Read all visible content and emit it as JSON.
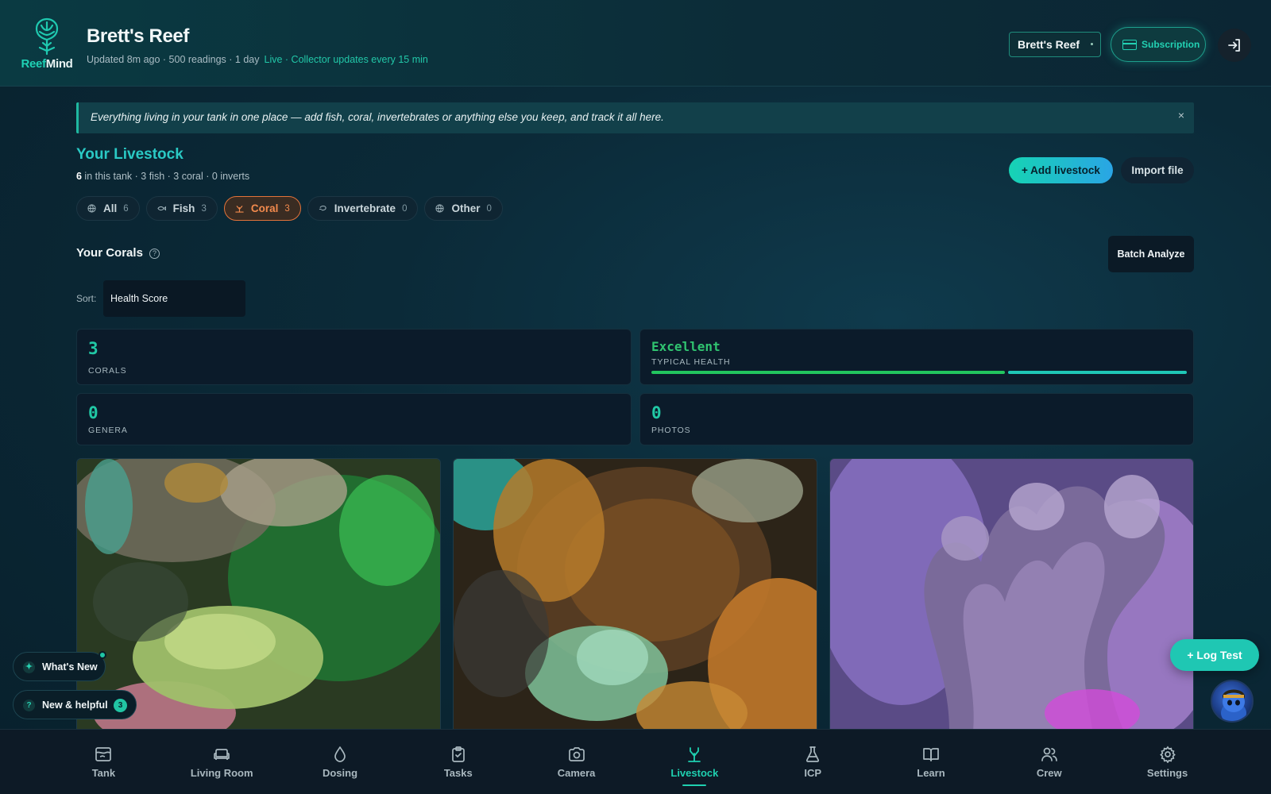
{
  "header": {
    "logo_part1": "Reef",
    "logo_part2": "Mind",
    "title": "Brett's Reef",
    "subline": "Updated 8m ago · 500 readings · 1 day",
    "live": "Live · Collector updates every 15 min",
    "tank_select": "Brett's Reef",
    "subscription_label": "Subscription"
  },
  "banner": {
    "text": "Everything living in your tank in one place — add fish, coral, invertebrates or anything else you keep, and track it all here.",
    "close": "×"
  },
  "livestock": {
    "title": "Your Livestock",
    "count_bold": "6",
    "count_rest": " in this tank · 3 fish · 3 coral · 0 inverts",
    "add_label": "+ Add livestock",
    "import_label": "Import file"
  },
  "filters": [
    {
      "label": "All",
      "count": "6",
      "icon": "globe-icon"
    },
    {
      "label": "Fish",
      "count": "3",
      "icon": "fish-icon"
    },
    {
      "label": "Coral",
      "count": "3",
      "icon": "coral-icon",
      "active": true
    },
    {
      "label": "Invertebrate",
      "count": "0",
      "icon": "shrimp-icon"
    },
    {
      "label": "Other",
      "count": "0",
      "icon": "globe-icon"
    }
  ],
  "corals": {
    "title": "Your Corals",
    "help": "?",
    "batch_label": "Batch Analyze",
    "sort_label": "Sort:",
    "sort_value": "Health Score"
  },
  "stats": {
    "corals": {
      "value": "3",
      "label": "CORALS"
    },
    "health": {
      "value": "Excellent",
      "label": "TYPICAL HEALTH",
      "bar_fill": 1.0
    },
    "genera": {
      "value": "0",
      "label": "GENERA"
    },
    "photos": {
      "value": "0",
      "label": "PHOTOS"
    }
  },
  "floating": {
    "whats_new": "What's New",
    "spark": "✦",
    "helpful": "New & helpful",
    "helpful_q": "?",
    "helpful_badge": "3",
    "log_test": "+ Log Test"
  },
  "nav": [
    {
      "label": "Tank",
      "icon": "tank-icon"
    },
    {
      "label": "Living Room",
      "icon": "sofa-icon"
    },
    {
      "label": "Dosing",
      "icon": "droplet-icon"
    },
    {
      "label": "Tasks",
      "icon": "clipboard-icon"
    },
    {
      "label": "Camera",
      "icon": "camera-icon"
    },
    {
      "label": "Livestock",
      "icon": "coral-icon",
      "active": true
    },
    {
      "label": "ICP",
      "icon": "flask-icon"
    },
    {
      "label": "Learn",
      "icon": "book-icon"
    },
    {
      "label": "Crew",
      "icon": "users-icon"
    },
    {
      "label": "Settings",
      "icon": "gear-icon"
    }
  ],
  "colors": {
    "accent": "#1fd0b0",
    "coral_active": "#f28a4d",
    "health_green": "#22c55e"
  }
}
